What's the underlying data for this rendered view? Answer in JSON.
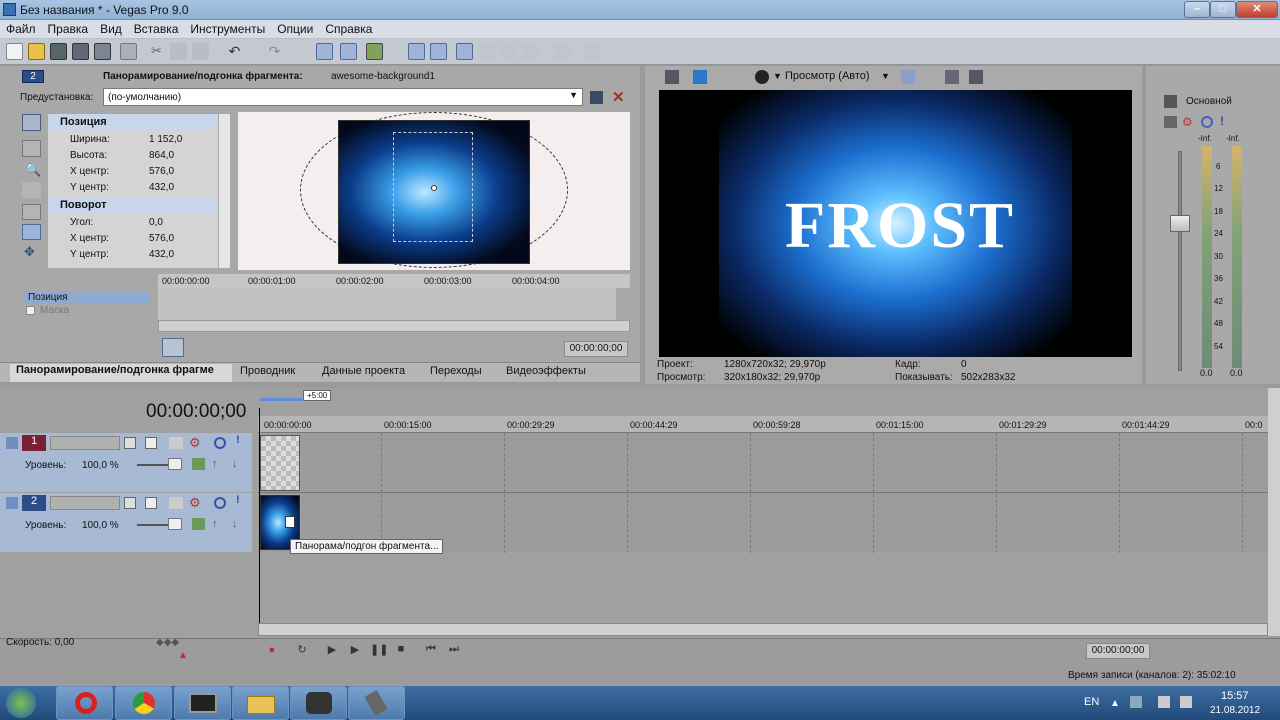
{
  "window": {
    "title": "Без названия * - Vegas Pro 9.0"
  },
  "menu": [
    "Файл",
    "Правка",
    "Вид",
    "Вставка",
    "Инструменты",
    "Опции",
    "Справка"
  ],
  "panzoom": {
    "track_num": "2",
    "title_label": "Панорамирование/подгонка фрагмента:",
    "title_value": "awesome-background1",
    "preset_label": "Предустановка:",
    "preset_value": "(по-умолчанию)",
    "sections": [
      {
        "name": "Позиция",
        "props": [
          {
            "label": "Ширина:",
            "value": "1 152,0"
          },
          {
            "label": "Высота:",
            "value": "864,0"
          },
          {
            "label": "X центр:",
            "value": "576,0"
          },
          {
            "label": "Y центр:",
            "value": "432,0"
          }
        ]
      },
      {
        "name": "Поворот",
        "props": [
          {
            "label": "Угол:",
            "value": "0,0"
          },
          {
            "label": "X центр:",
            "value": "576,0"
          },
          {
            "label": "Y центр:",
            "value": "432,0"
          }
        ]
      }
    ],
    "kf_ruler": [
      "00:00:00:00",
      "00:00:01:00",
      "00:00:02:00",
      "00:00:03:00",
      "00:00:04:00"
    ],
    "kf_tracks": [
      "Позиция",
      "Маска"
    ],
    "kf_time": "00:00:00;00"
  },
  "tabs": [
    "Панорамирование/подгонка фрагме",
    "Проводник",
    "Данные проекта",
    "Переходы",
    "Видеоэффекты"
  ],
  "preview": {
    "mode": "Просмотр (Авто)",
    "image_text": "FROST",
    "info": {
      "project_label": "Проект:",
      "project_value": "1280x720x32; 29,970p",
      "preview_label": "Просмотр:",
      "preview_value": "320x180x32; 29,970p",
      "frame_label": "Кадр:",
      "frame_value": "0",
      "display_label": "Показывать:",
      "display_value": "502x283x32"
    }
  },
  "mixer": {
    "label": "Основной",
    "inf_left": "-Inf.",
    "inf_right": "-Inf.",
    "scale": [
      "6",
      "12",
      "18",
      "24",
      "30",
      "36",
      "42",
      "48",
      "54"
    ],
    "bottom_left": "0.0",
    "bottom_right": "0.0"
  },
  "timeline": {
    "timecode": "00:00:00;00",
    "offset": "+5:00",
    "ruler": [
      "00:00:00:00",
      "00:00:15:00",
      "00:00:29:29",
      "00:00:44:29",
      "00:00:59:28",
      "00:01:15:00",
      "00:01:29:29",
      "00:01:44:29",
      "00:0"
    ],
    "tracks": [
      {
        "num": "1",
        "level_label": "Уровень:",
        "level_value": "100,0 %"
      },
      {
        "num": "2",
        "level_label": "Уровень:",
        "level_value": "100,0 %"
      }
    ],
    "tooltip": "Панорама/подгон фрагмента...",
    "speed": "Скорость: 0,00",
    "transport_time": "00:00:00;00",
    "record_time": "Время записи (каналов: 2): 35:02:10"
  },
  "taskbar": {
    "lang": "EN",
    "time": "15:57",
    "date": "21.08.2012"
  }
}
